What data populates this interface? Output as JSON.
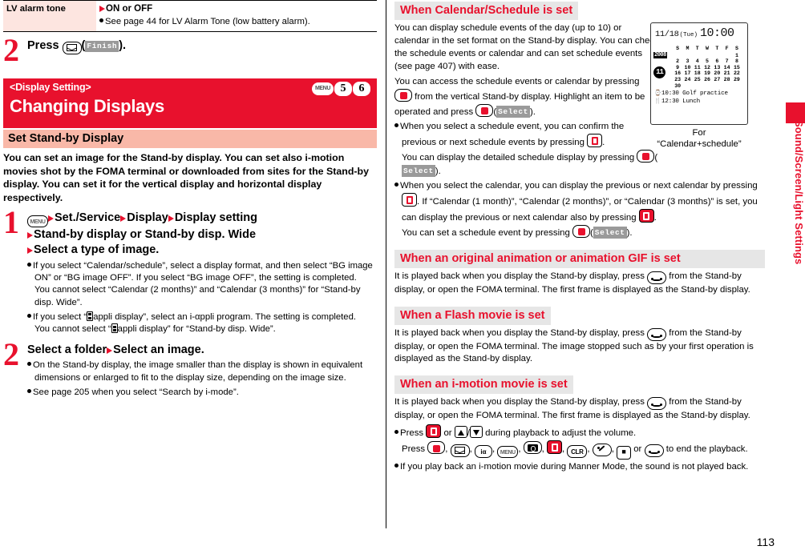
{
  "page": {
    "number": "113",
    "side_tab": "Sound/Screen/Light Settings",
    "accent_red": "#e8112d",
    "pink_bar": "#f9b8a8",
    "table_cell_pink": "#fde5e0",
    "grey_bar": "#e6e6e6"
  },
  "table": {
    "label": "LV alarm tone",
    "value": "ON or OFF",
    "note": "See page 44 for LV Alarm Tone (low battery alarm)."
  },
  "step_top": {
    "number": "2",
    "text_before": "Press",
    "key": "mail-key",
    "softkey": "Finish",
    "text_after": ")."
  },
  "banner": {
    "subtitle": "<Display Setting>",
    "title": "Changing Displays",
    "keys": [
      "MENU",
      "5",
      "6"
    ]
  },
  "section": {
    "heading": "Set Stand-by Display",
    "lead": "You can set an image for the Stand-by display. You can set also i-motion movies shot by the FOMA terminal or downloaded from sites for the Stand-by display. You can set it for the vertical display and horizontal display respectively."
  },
  "steps": [
    {
      "number": "1",
      "line1_parts": [
        "Set./Service",
        "Display",
        "Display setting"
      ],
      "line2": "Stand-by display or Stand-by disp. Wide",
      "line3": "Select a type of image.",
      "notes": [
        "If you select “Calendar/schedule”, select a display format, and then select “BG image ON” or “BG image OFF”. If you select “BG image OFF”, the setting is completed.",
        "You cannot select “Calendar (2 months)” and “Calendar (3 months)” for “Stand-by disp. Wide”.",
        "appli display”, select an i-αppli program. The setting is completed.",
        "appli display” for “Stand-by disp. Wide”."
      ],
      "note3_prefix": "If you select “",
      "note4_prefix": "You cannot select “"
    },
    {
      "number": "2",
      "title_a": "Select a folder",
      "title_b": "Select an image.",
      "notes": [
        "On the Stand-by display, the image smaller than the display is shown in equivalent dimensions or enlarged to fit to the display size, depending on the image size.",
        "See page 205 when you select “Search by i-mode”."
      ]
    }
  ],
  "right": {
    "sections": [
      {
        "heading": "When Calendar/Schedule is set",
        "paragraphs": [
          "You can display schedule events of the day (up to 10) or calendar in the set format on the Stand-by display. You can check the schedule events or calendar and can set schedule events (see page 407) with ease.",
          "You can access the schedule events or calendar by pressing"
        ],
        "p2_tail": "from the vertical Stand-by display. Highlight an item to be operated and press",
        "p2_softkey": "Select",
        "notes": [
          {
            "lead": "When you select a schedule event, you can confirm the previous or next schedule events by pressing",
            "cont": "You can display the detailed schedule display by pressing",
            "softkey": "Select"
          },
          {
            "lead": "When you select the calendar, you can display the previous or next calendar by pressing",
            "mid": ". If “Calendar (1 month)”, “Calendar (2 months)”, or “Calendar (3 months)” is set, you can display the previous or next calendar also by pressing",
            "cont": "You can set a schedule event by pressing",
            "softkey": "Select"
          }
        ]
      },
      {
        "heading": "When an original animation or animation GIF is set",
        "body_a": "It is played back when you display the Stand-by display, press",
        "body_b": "from the Stand-by display, or open the FOMA terminal. The first frame is displayed as the Stand-by display."
      },
      {
        "heading": "When a Flash movie is set",
        "body_a": "It is played back when you display the Stand-by display, press",
        "body_b": "from the Stand-by display, or open the FOMA terminal. The image stopped such as by your first operation is displayed as the Stand-by display."
      },
      {
        "heading": "When an i-motion movie is set",
        "body_a": "It is played back when you display the Stand-by display, press",
        "body_b": "from the Stand-by display, or open the FOMA terminal. The first frame is displayed as the Stand-by display.",
        "notes": [
          {
            "pre": "Press",
            "mid": "or",
            "post": "during playback to adjust the volume."
          },
          {
            "pre": "Press",
            "post": "to end the playback.",
            "or_word": "or"
          },
          {
            "text": "If you play back an i-motion movie during Manner Mode, the sound is not played back."
          }
        ]
      }
    ],
    "figure": {
      "screen": {
        "date": "11/18",
        "dow": "(Tue)",
        "time": "10:00",
        "year": "2008",
        "month": "11",
        "weekday_headers": [
          "S",
          "M",
          "T",
          "W",
          "T",
          "F",
          "S"
        ],
        "weeks": [
          [
            "",
            "",
            "",
            "",
            "",
            "",
            "1"
          ],
          [
            "2",
            "3",
            "4",
            "5",
            "6",
            "7",
            "8"
          ],
          [
            "9",
            "10",
            "11",
            "12",
            "13",
            "14",
            "15"
          ],
          [
            "16",
            "17",
            "18",
            "19",
            "20",
            "21",
            "22"
          ],
          [
            "23",
            "24",
            "25",
            "26",
            "27",
            "28",
            "29"
          ],
          [
            "30",
            "",
            "",
            "",
            "",
            "",
            ""
          ]
        ],
        "events": [
          {
            "icon": "⌚",
            "time": "10:30",
            "title": "Golf practice"
          },
          {
            "icon": "🍴",
            "time": "12:30",
            "title": "Lunch"
          }
        ]
      },
      "caption_line1": "For",
      "caption_line2": "“Calendar+schedule”"
    }
  }
}
